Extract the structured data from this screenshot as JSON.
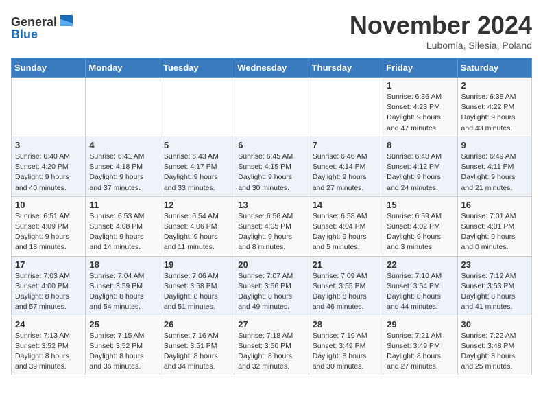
{
  "header": {
    "logo_line1": "General",
    "logo_line2": "Blue",
    "month": "November 2024",
    "location": "Lubomia, Silesia, Poland"
  },
  "weekdays": [
    "Sunday",
    "Monday",
    "Tuesday",
    "Wednesday",
    "Thursday",
    "Friday",
    "Saturday"
  ],
  "weeks": [
    [
      {
        "day": "",
        "info": ""
      },
      {
        "day": "",
        "info": ""
      },
      {
        "day": "",
        "info": ""
      },
      {
        "day": "",
        "info": ""
      },
      {
        "day": "",
        "info": ""
      },
      {
        "day": "1",
        "info": "Sunrise: 6:36 AM\nSunset: 4:23 PM\nDaylight: 9 hours\nand 47 minutes."
      },
      {
        "day": "2",
        "info": "Sunrise: 6:38 AM\nSunset: 4:22 PM\nDaylight: 9 hours\nand 43 minutes."
      }
    ],
    [
      {
        "day": "3",
        "info": "Sunrise: 6:40 AM\nSunset: 4:20 PM\nDaylight: 9 hours\nand 40 minutes."
      },
      {
        "day": "4",
        "info": "Sunrise: 6:41 AM\nSunset: 4:18 PM\nDaylight: 9 hours\nand 37 minutes."
      },
      {
        "day": "5",
        "info": "Sunrise: 6:43 AM\nSunset: 4:17 PM\nDaylight: 9 hours\nand 33 minutes."
      },
      {
        "day": "6",
        "info": "Sunrise: 6:45 AM\nSunset: 4:15 PM\nDaylight: 9 hours\nand 30 minutes."
      },
      {
        "day": "7",
        "info": "Sunrise: 6:46 AM\nSunset: 4:14 PM\nDaylight: 9 hours\nand 27 minutes."
      },
      {
        "day": "8",
        "info": "Sunrise: 6:48 AM\nSunset: 4:12 PM\nDaylight: 9 hours\nand 24 minutes."
      },
      {
        "day": "9",
        "info": "Sunrise: 6:49 AM\nSunset: 4:11 PM\nDaylight: 9 hours\nand 21 minutes."
      }
    ],
    [
      {
        "day": "10",
        "info": "Sunrise: 6:51 AM\nSunset: 4:09 PM\nDaylight: 9 hours\nand 18 minutes."
      },
      {
        "day": "11",
        "info": "Sunrise: 6:53 AM\nSunset: 4:08 PM\nDaylight: 9 hours\nand 14 minutes."
      },
      {
        "day": "12",
        "info": "Sunrise: 6:54 AM\nSunset: 4:06 PM\nDaylight: 9 hours\nand 11 minutes."
      },
      {
        "day": "13",
        "info": "Sunrise: 6:56 AM\nSunset: 4:05 PM\nDaylight: 9 hours\nand 8 minutes."
      },
      {
        "day": "14",
        "info": "Sunrise: 6:58 AM\nSunset: 4:04 PM\nDaylight: 9 hours\nand 5 minutes."
      },
      {
        "day": "15",
        "info": "Sunrise: 6:59 AM\nSunset: 4:02 PM\nDaylight: 9 hours\nand 3 minutes."
      },
      {
        "day": "16",
        "info": "Sunrise: 7:01 AM\nSunset: 4:01 PM\nDaylight: 9 hours\nand 0 minutes."
      }
    ],
    [
      {
        "day": "17",
        "info": "Sunrise: 7:03 AM\nSunset: 4:00 PM\nDaylight: 8 hours\nand 57 minutes."
      },
      {
        "day": "18",
        "info": "Sunrise: 7:04 AM\nSunset: 3:59 PM\nDaylight: 8 hours\nand 54 minutes."
      },
      {
        "day": "19",
        "info": "Sunrise: 7:06 AM\nSunset: 3:58 PM\nDaylight: 8 hours\nand 51 minutes."
      },
      {
        "day": "20",
        "info": "Sunrise: 7:07 AM\nSunset: 3:56 PM\nDaylight: 8 hours\nand 49 minutes."
      },
      {
        "day": "21",
        "info": "Sunrise: 7:09 AM\nSunset: 3:55 PM\nDaylight: 8 hours\nand 46 minutes."
      },
      {
        "day": "22",
        "info": "Sunrise: 7:10 AM\nSunset: 3:54 PM\nDaylight: 8 hours\nand 44 minutes."
      },
      {
        "day": "23",
        "info": "Sunrise: 7:12 AM\nSunset: 3:53 PM\nDaylight: 8 hours\nand 41 minutes."
      }
    ],
    [
      {
        "day": "24",
        "info": "Sunrise: 7:13 AM\nSunset: 3:52 PM\nDaylight: 8 hours\nand 39 minutes."
      },
      {
        "day": "25",
        "info": "Sunrise: 7:15 AM\nSunset: 3:52 PM\nDaylight: 8 hours\nand 36 minutes."
      },
      {
        "day": "26",
        "info": "Sunrise: 7:16 AM\nSunset: 3:51 PM\nDaylight: 8 hours\nand 34 minutes."
      },
      {
        "day": "27",
        "info": "Sunrise: 7:18 AM\nSunset: 3:50 PM\nDaylight: 8 hours\nand 32 minutes."
      },
      {
        "day": "28",
        "info": "Sunrise: 7:19 AM\nSunset: 3:49 PM\nDaylight: 8 hours\nand 30 minutes."
      },
      {
        "day": "29",
        "info": "Sunrise: 7:21 AM\nSunset: 3:49 PM\nDaylight: 8 hours\nand 27 minutes."
      },
      {
        "day": "30",
        "info": "Sunrise: 7:22 AM\nSunset: 3:48 PM\nDaylight: 8 hours\nand 25 minutes."
      }
    ]
  ]
}
